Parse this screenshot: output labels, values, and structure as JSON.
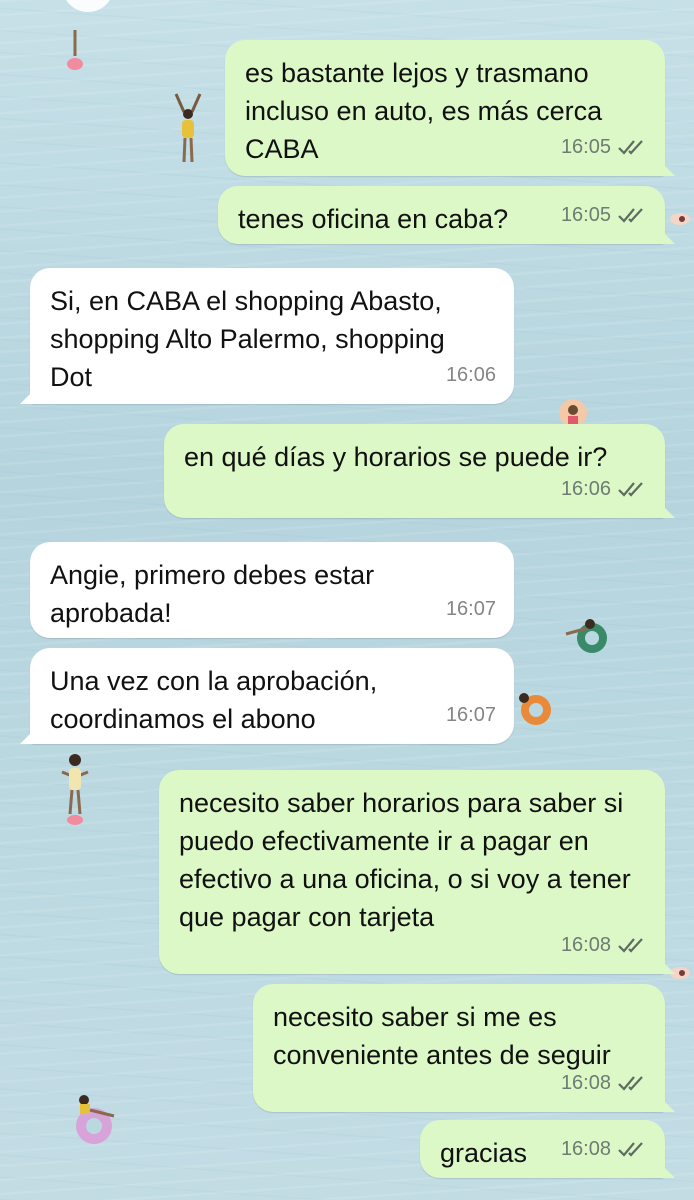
{
  "chat": {
    "messages": [
      {
        "dir": "out",
        "text": "es bastante lejos y trasmano incluso en auto, es más cerca CABA",
        "time": "16:05",
        "status": "read"
      },
      {
        "dir": "out",
        "text": "tenes oficina en caba?",
        "time": "16:05",
        "status": "read"
      },
      {
        "dir": "in",
        "text": "Si, en CABA el shopping Abasto, shopping Alto Palermo, shopping Dot",
        "time": "16:06"
      },
      {
        "dir": "out",
        "text": "en qué días y horarios se puede ir?",
        "time": "16:06",
        "status": "read"
      },
      {
        "dir": "in",
        "text": "Angie, primero debes estar aprobada!",
        "time": "16:07"
      },
      {
        "dir": "in",
        "text": "Una vez con la aprobación, coordinamos el abono",
        "time": "16:07"
      },
      {
        "dir": "out",
        "text": "necesito saber horarios para saber si puedo efectivamente ir a pagar en efectivo a una oficina, o si voy a tener que pagar con tarjeta",
        "time": "16:08",
        "status": "read"
      },
      {
        "dir": "out",
        "text": "necesito saber si me es conveniente antes de seguir",
        "time": "16:08",
        "status": "read"
      },
      {
        "dir": "out",
        "text": "gracias",
        "time": "16:08",
        "status": "read"
      }
    ]
  },
  "colors": {
    "outgoing_bubble": "#dcf8c6",
    "incoming_bubble": "#ffffff",
    "read_ticks": "#5f6b62",
    "wallpaper": "#b9d8e0"
  },
  "icons": {
    "status": "double-check-icon"
  }
}
